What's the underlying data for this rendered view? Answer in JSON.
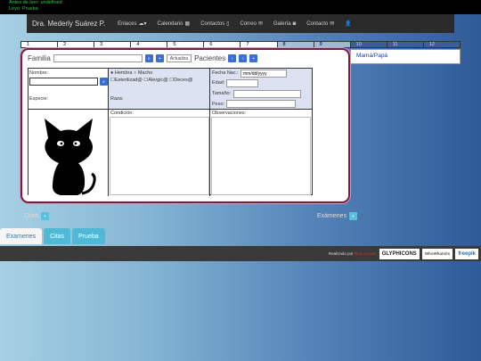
{
  "debug": {
    "line1": "Antes de leer: undefined",
    "line2": "Leyó: Prueba"
  },
  "nav": {
    "brand": "Dra. Mederly Suárez P.",
    "items": [
      {
        "label": "Enlaces",
        "icon": "cloud-caret-icon"
      },
      {
        "label": "Calendario",
        "icon": "calendar-icon"
      },
      {
        "label": "Contactos",
        "icon": "phone-icon"
      },
      {
        "label": "Correo",
        "icon": "envelope-icon"
      },
      {
        "label": "Galería",
        "icon": "camera-icon"
      },
      {
        "label": "Contacto",
        "icon": "envelope-icon"
      }
    ]
  },
  "days": [
    "1",
    "2",
    "3",
    "4",
    "5",
    "6",
    "7",
    "8",
    "9",
    "10",
    "11",
    "12"
  ],
  "form": {
    "familia_label": "Familia",
    "actualiza": "Actualiza",
    "pacientes_label": "Pacientes",
    "nombre": "Nombre:",
    "especie": "Especie:",
    "raza": "Raza:",
    "condicion": "Condición:",
    "observaciones": "Observaciones:",
    "hembra": "Hembra",
    "macho": "Macho",
    "esterilizado": "Esterilizad@",
    "alergico": "Alergic@",
    "deceso": "Deces@",
    "fecha_nac": "Fecha Nac.:",
    "fecha_placeholder": "mm/dd/yyyy",
    "edad": "Edad:",
    "tamano": "Tamaño:",
    "peso": "Peso:"
  },
  "side_panel": "Mamá/Papá",
  "labels": {
    "citas": "Citas",
    "examenes": "Exámenes"
  },
  "tabs": [
    "Examenes",
    "Citas",
    "Prueba"
  ],
  "footer": {
    "realizado": "Realizado por",
    "author": "Ruly Gómez",
    "logos": [
      "GLYPHICONS",
      "WhoWhatsits",
      "freepik"
    ]
  }
}
